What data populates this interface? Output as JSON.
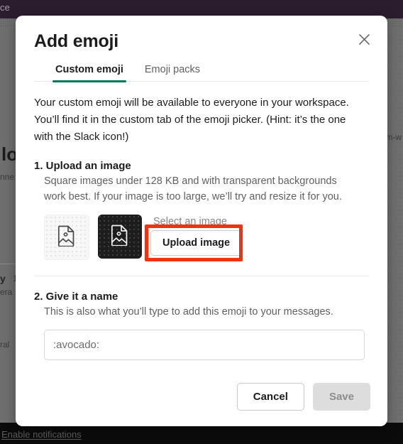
{
  "background": {
    "topbar_text": "ce",
    "bottom_link": "Enable notifications",
    "fragments": {
      "left_big": "lo",
      "left_small1": "nne",
      "left_med": "y",
      "left_small2": "1",
      "left_small3": "era",
      "left_small4": "ral",
      "right_small1": "m-w"
    }
  },
  "modal": {
    "title": "Add emoji",
    "close_icon": "close-icon",
    "tabs": [
      {
        "label": "Custom emoji",
        "active": true
      },
      {
        "label": "Emoji packs",
        "active": false
      }
    ],
    "intro": "Your custom emoji will be available to everyone in your workspace. You’ll find it in the custom tab of the emoji picker. (Hint: it’s the one with the Slack icon!)",
    "step1": {
      "title": "1. Upload an image",
      "description": "Square images under 128 KB and with transparent backgrounds work best. If your image is too large, we’ll try and resize it for you.",
      "preview_light_icon": "image-file-icon",
      "preview_dark_icon": "image-file-icon",
      "select_label": "Select an image",
      "upload_button": "Upload image"
    },
    "step2": {
      "title": "2. Give it a name",
      "description": "This is also what you’ll type to add this emoji to your messages.",
      "name_value": ":avocado:",
      "name_placeholder": ":avocado:"
    },
    "footer": {
      "cancel_label": "Cancel",
      "save_label": "Save"
    }
  },
  "colors": {
    "accent_green": "#007a5a",
    "annotation_red": "#f0330f",
    "topbar_purple": "#2b1d2e",
    "text_primary": "#1d1c1d",
    "text_secondary": "#616061"
  }
}
